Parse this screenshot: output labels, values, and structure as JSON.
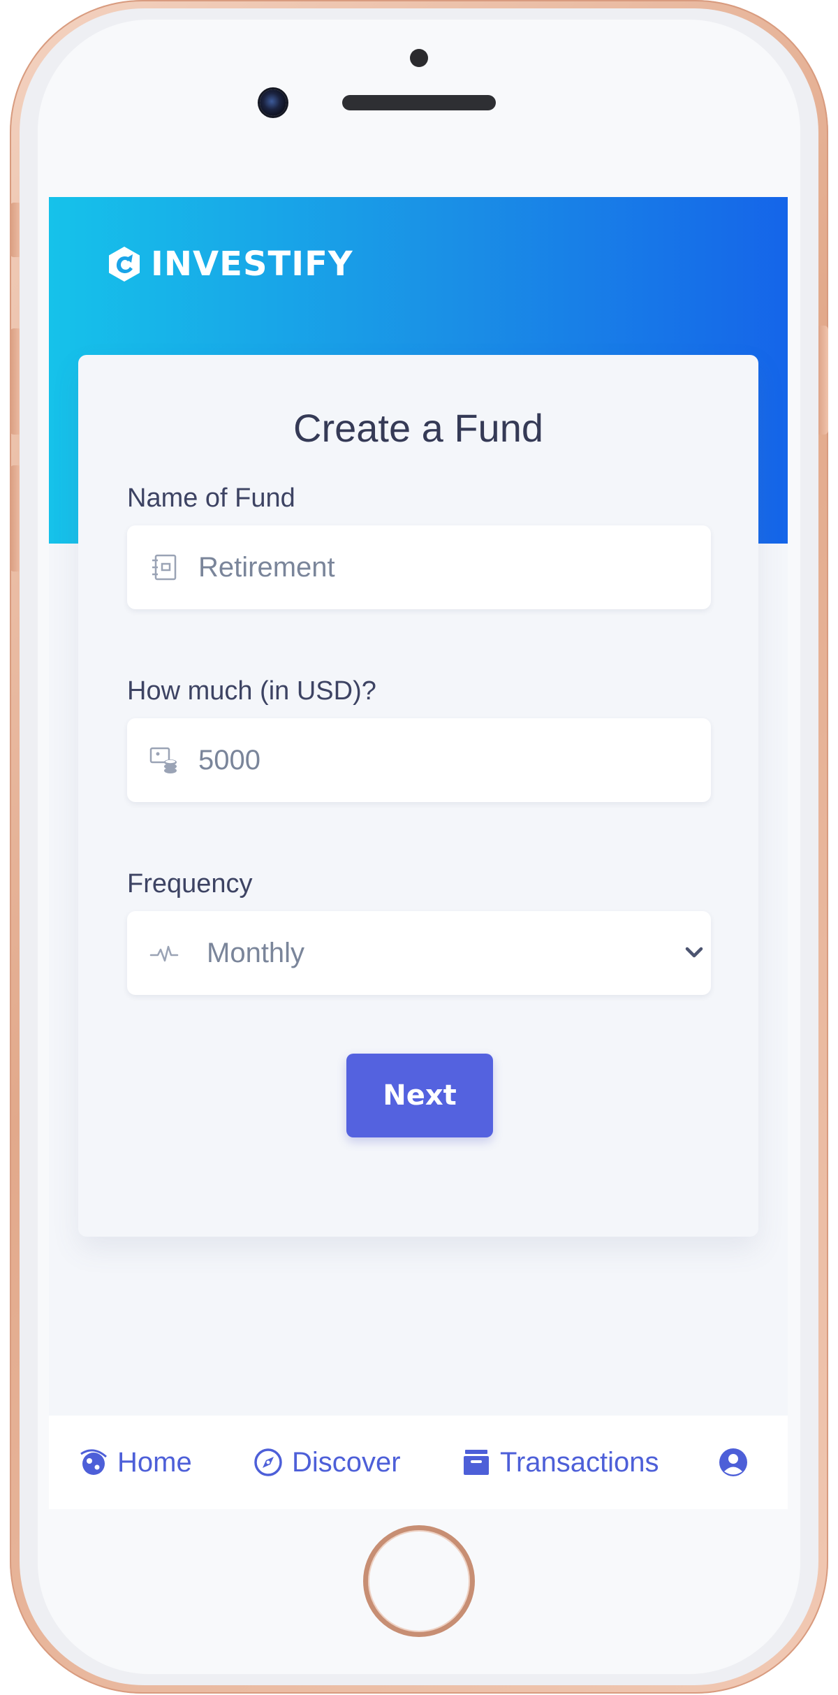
{
  "app": {
    "brand": "INVESTIFY"
  },
  "form": {
    "title": "Create a Fund",
    "name_field": {
      "label": "Name of Fund",
      "value": "Retirement",
      "icon": "notebook-icon"
    },
    "amount_field": {
      "label": "How much (in USD)?",
      "value": "5000",
      "icon": "coins-icon"
    },
    "frequency_field": {
      "label": "Frequency",
      "value": "Monthly",
      "icon": "pulse-icon"
    },
    "next_label": "Next"
  },
  "tabbar": {
    "items": [
      {
        "label": "Home",
        "icon": "globe-icon"
      },
      {
        "label": "Discover",
        "icon": "compass-icon"
      },
      {
        "label": "Transactions",
        "icon": "archive-icon"
      },
      {
        "label": "",
        "icon": "user-circle-icon"
      }
    ]
  },
  "colors": {
    "hero_start": "#16c2ea",
    "hero_end": "#1565e9",
    "accent": "#5462df",
    "tab_text": "#4d5fd8",
    "title_text": "#353a56"
  }
}
